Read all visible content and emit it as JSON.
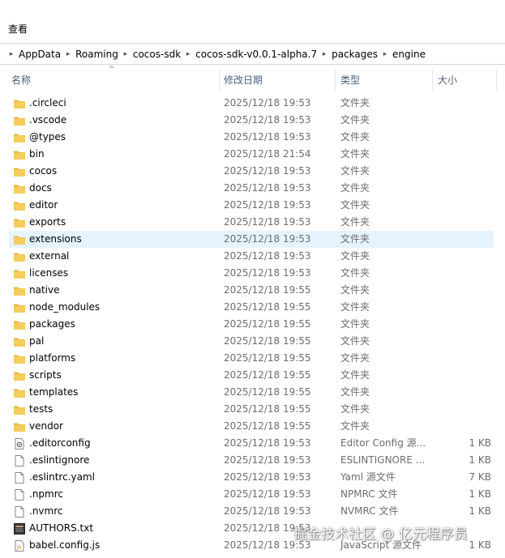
{
  "menu": {
    "view_label": "查看"
  },
  "breadcrumb": [
    "AppData",
    "Roaming",
    "cocos-sdk",
    "cocos-sdk-v0.0.1-alpha.7",
    "packages",
    "engine"
  ],
  "columns": {
    "name": "名称",
    "date": "修改日期",
    "type": "类型",
    "size": "大小"
  },
  "files": [
    {
      "name": ".circleci",
      "date": "2025/12/18 19:53",
      "type": "文件夹",
      "size": "",
      "icon": "folder-icon"
    },
    {
      "name": ".vscode",
      "date": "2025/12/18 19:53",
      "type": "文件夹",
      "size": "",
      "icon": "folder-icon"
    },
    {
      "name": "@types",
      "date": "2025/12/18 19:53",
      "type": "文件夹",
      "size": "",
      "icon": "folder-icon"
    },
    {
      "name": "bin",
      "date": "2025/12/18 21:54",
      "type": "文件夹",
      "size": "",
      "icon": "folder-icon"
    },
    {
      "name": "cocos",
      "date": "2025/12/18 19:53",
      "type": "文件夹",
      "size": "",
      "icon": "folder-icon"
    },
    {
      "name": "docs",
      "date": "2025/12/18 19:53",
      "type": "文件夹",
      "size": "",
      "icon": "folder-icon"
    },
    {
      "name": "editor",
      "date": "2025/12/18 19:53",
      "type": "文件夹",
      "size": "",
      "icon": "folder-icon"
    },
    {
      "name": "exports",
      "date": "2025/12/18 19:53",
      "type": "文件夹",
      "size": "",
      "icon": "folder-icon"
    },
    {
      "name": "extensions",
      "date": "2025/12/18 19:53",
      "type": "文件夹",
      "size": "",
      "icon": "folder-icon",
      "selected": true
    },
    {
      "name": "external",
      "date": "2025/12/18 19:53",
      "type": "文件夹",
      "size": "",
      "icon": "folder-icon"
    },
    {
      "name": "licenses",
      "date": "2025/12/18 19:53",
      "type": "文件夹",
      "size": "",
      "icon": "folder-icon"
    },
    {
      "name": "native",
      "date": "2025/12/18 19:55",
      "type": "文件夹",
      "size": "",
      "icon": "folder-icon"
    },
    {
      "name": "node_modules",
      "date": "2025/12/18 19:55",
      "type": "文件夹",
      "size": "",
      "icon": "folder-icon"
    },
    {
      "name": "packages",
      "date": "2025/12/18 19:55",
      "type": "文件夹",
      "size": "",
      "icon": "folder-icon"
    },
    {
      "name": "pal",
      "date": "2025/12/18 19:55",
      "type": "文件夹",
      "size": "",
      "icon": "folder-icon"
    },
    {
      "name": "platforms",
      "date": "2025/12/18 19:55",
      "type": "文件夹",
      "size": "",
      "icon": "folder-icon"
    },
    {
      "name": "scripts",
      "date": "2025/12/18 19:55",
      "type": "文件夹",
      "size": "",
      "icon": "folder-icon"
    },
    {
      "name": "templates",
      "date": "2025/12/18 19:55",
      "type": "文件夹",
      "size": "",
      "icon": "folder-icon"
    },
    {
      "name": "tests",
      "date": "2025/12/18 19:55",
      "type": "文件夹",
      "size": "",
      "icon": "folder-icon"
    },
    {
      "name": "vendor",
      "date": "2025/12/18 19:55",
      "type": "文件夹",
      "size": "",
      "icon": "folder-icon"
    },
    {
      "name": ".editorconfig",
      "date": "2025/12/18 19:53",
      "type": "Editor Config 源...",
      "size": "1 KB",
      "icon": "config-file-icon"
    },
    {
      "name": ".eslintignore",
      "date": "2025/12/18 19:53",
      "type": "ESLINTIGNORE ...",
      "size": "1 KB",
      "icon": "file-icon"
    },
    {
      "name": ".eslintrc.yaml",
      "date": "2025/12/18 19:53",
      "type": "Yaml 源文件",
      "size": "7 KB",
      "icon": "file-icon"
    },
    {
      "name": ".npmrc",
      "date": "2025/12/18 19:53",
      "type": "NPMRC 文件",
      "size": "1 KB",
      "icon": "file-icon"
    },
    {
      "name": ".nvmrc",
      "date": "2025/12/18 19:53",
      "type": "NVMRC 文件",
      "size": "1 KB",
      "icon": "file-icon"
    },
    {
      "name": "AUTHORS.txt",
      "date": "2025/12/18 19:53",
      "type": "",
      "size": "",
      "icon": "text-file-icon"
    },
    {
      "name": "babel.config.js",
      "date": "2025/12/18 19:53",
      "type": "JavaScript 源文件",
      "size": "1 KB",
      "icon": "js-file-icon"
    }
  ],
  "watermark": "掘金技术社区 @ 亿元程序员",
  "colors": {
    "selection": "#e5f3ff",
    "folder": "#f6cd5b",
    "header_text": "#4c607a"
  }
}
